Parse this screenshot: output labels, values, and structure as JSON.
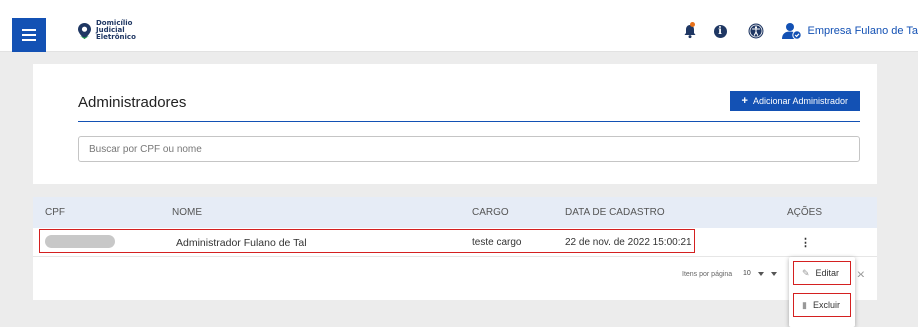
{
  "header": {
    "logo_lines": [
      "Domicílio",
      "Judicial",
      "Eletrônico"
    ],
    "company": "Empresa Fulano de Ta",
    "icons": [
      "menu-icon",
      "bell-icon",
      "info-icon",
      "accessibility-icon",
      "user-icon"
    ],
    "colors": {
      "primary": "#1351b4",
      "notification": "#e8711a"
    }
  },
  "page": {
    "title": "Administradores",
    "add_button": "Adicionar Administrador",
    "search_placeholder": "Buscar por CPF ou nome"
  },
  "table": {
    "headers": {
      "cpf": "CPF",
      "nome": "NOME",
      "cargo": "CARGO",
      "data": "DATA DE CADASTRO",
      "acoes": "AÇÕES"
    },
    "rows": [
      {
        "nome": "Administrador Fulano de Tal",
        "cargo": "teste cargo",
        "data": "22 de nov. de 2022 15:00:21",
        "acoes": "⋮"
      }
    ]
  },
  "pagination": {
    "label": "Itens por página",
    "value": "10"
  },
  "actions_menu": {
    "edit": "Editar",
    "delete": "Excluir"
  }
}
